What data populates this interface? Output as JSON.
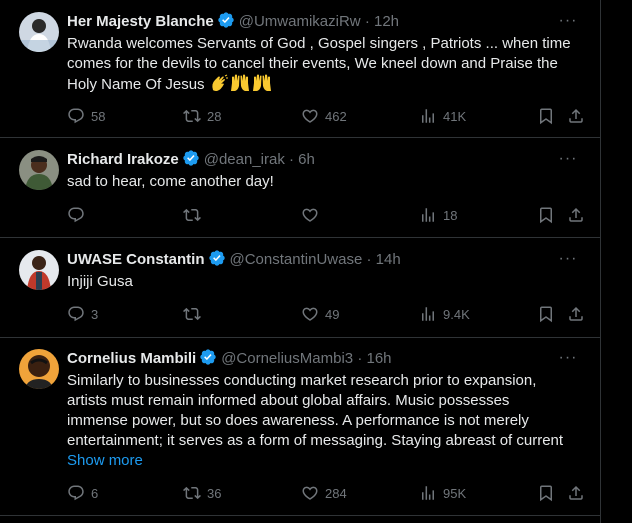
{
  "tweets": [
    {
      "name": "Her Majesty Blanche",
      "handle": "@UmwamikaziRw",
      "dot": "·",
      "time": "12h",
      "text": "Rwanda welcomes Servants of God , Gospel singers , Patriots ... when time comes for the devils to cancel their events, We kneel down and Praise the Holy Name Of Jesus",
      "replies": "58",
      "retweets": "28",
      "likes": "462",
      "views": "41K",
      "emoji": [
        "clapping-hands",
        "raising-hands",
        "raising-hands"
      ]
    },
    {
      "name": "Richard Irakoze",
      "handle": "@dean_irak",
      "dot": "·",
      "time": "6h",
      "text": "sad to hear, come another day!",
      "replies": "",
      "retweets": "",
      "likes": "",
      "views": "18"
    },
    {
      "name": "UWASE Constantin",
      "handle": "@ConstantinUwase",
      "dot": "·",
      "time": "14h",
      "text": "Injiji Gusa",
      "replies": "3",
      "retweets": "",
      "likes": "49",
      "views": "9.4K"
    },
    {
      "name": "Cornelius Mambili",
      "handle": "@CorneliusMambi3",
      "dot": "·",
      "time": "16h",
      "text_lines": [
        "Similarly to businesses conducting market research prior to expansion,",
        "artists must remain informed about global affairs. Music possesses",
        "immense power, but so does awareness. A performance is not merely",
        "entertainment; it serves as a form of messaging. Staying abreast of current"
      ],
      "show_more": "Show more",
      "replies": "6",
      "retweets": "36",
      "likes": "284",
      "views": "95K"
    }
  ],
  "colors": {
    "background": "#000000",
    "text": "#e7e9ea",
    "muted": "#71767b",
    "accent": "#1d9bf0",
    "divider": "#2f3336"
  }
}
